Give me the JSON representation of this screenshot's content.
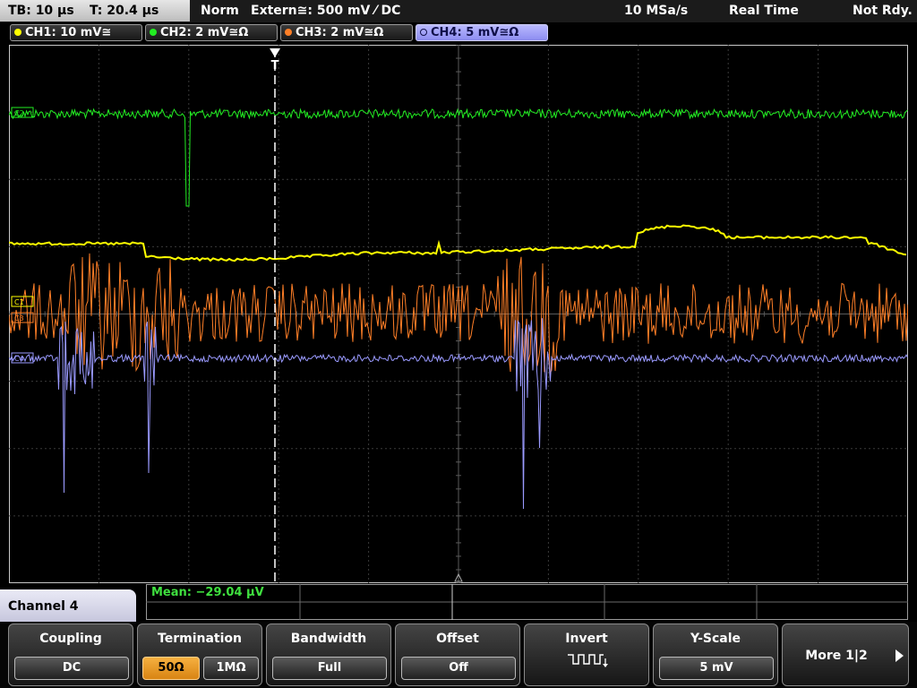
{
  "status": {
    "timebase": "TB: 10 µs",
    "trigger_time": "T: 20.4 µs",
    "mode": "Norm",
    "trigger_source": "Extern≅: 500 mV ⁄ DC",
    "sample_rate": "10 MSa/s",
    "acq_mode": "Real Time",
    "state": "Not Rdy."
  },
  "channels": [
    {
      "label": "CH1: 10 mV≅",
      "color": "#ffff00"
    },
    {
      "label": "CH2: 2 mV≅Ω",
      "color": "#22ee22"
    },
    {
      "label": "CH3: 2 mV≅Ω",
      "color": "#ff7f27"
    },
    {
      "label": "CH4: 5 mV≅Ω",
      "color": "#9a9aff"
    }
  ],
  "markers": {
    "trigger": "T",
    "ch2": "C2",
    "ch1": "C1",
    "ch3": "C3",
    "ch4": "C4"
  },
  "measurement": {
    "mean": "Mean: −29.04 µV"
  },
  "menu": {
    "title": "Channel 4",
    "coupling": {
      "label": "Coupling",
      "value": "DC"
    },
    "termination": {
      "label": "Termination",
      "opt1": "50Ω",
      "opt2": "1MΩ",
      "selected": "50Ω"
    },
    "bandwidth": {
      "label": "Bandwidth",
      "value": "Full"
    },
    "offset": {
      "label": "Offset",
      "value": "Off"
    },
    "invert": {
      "label": "Invert",
      "icon": "inverted-square-wave-icon"
    },
    "yscale": {
      "label": "Y-Scale",
      "value": "5 mV"
    },
    "more": {
      "label": "More 1|2",
      "icon": "triangle-right-icon"
    }
  }
}
